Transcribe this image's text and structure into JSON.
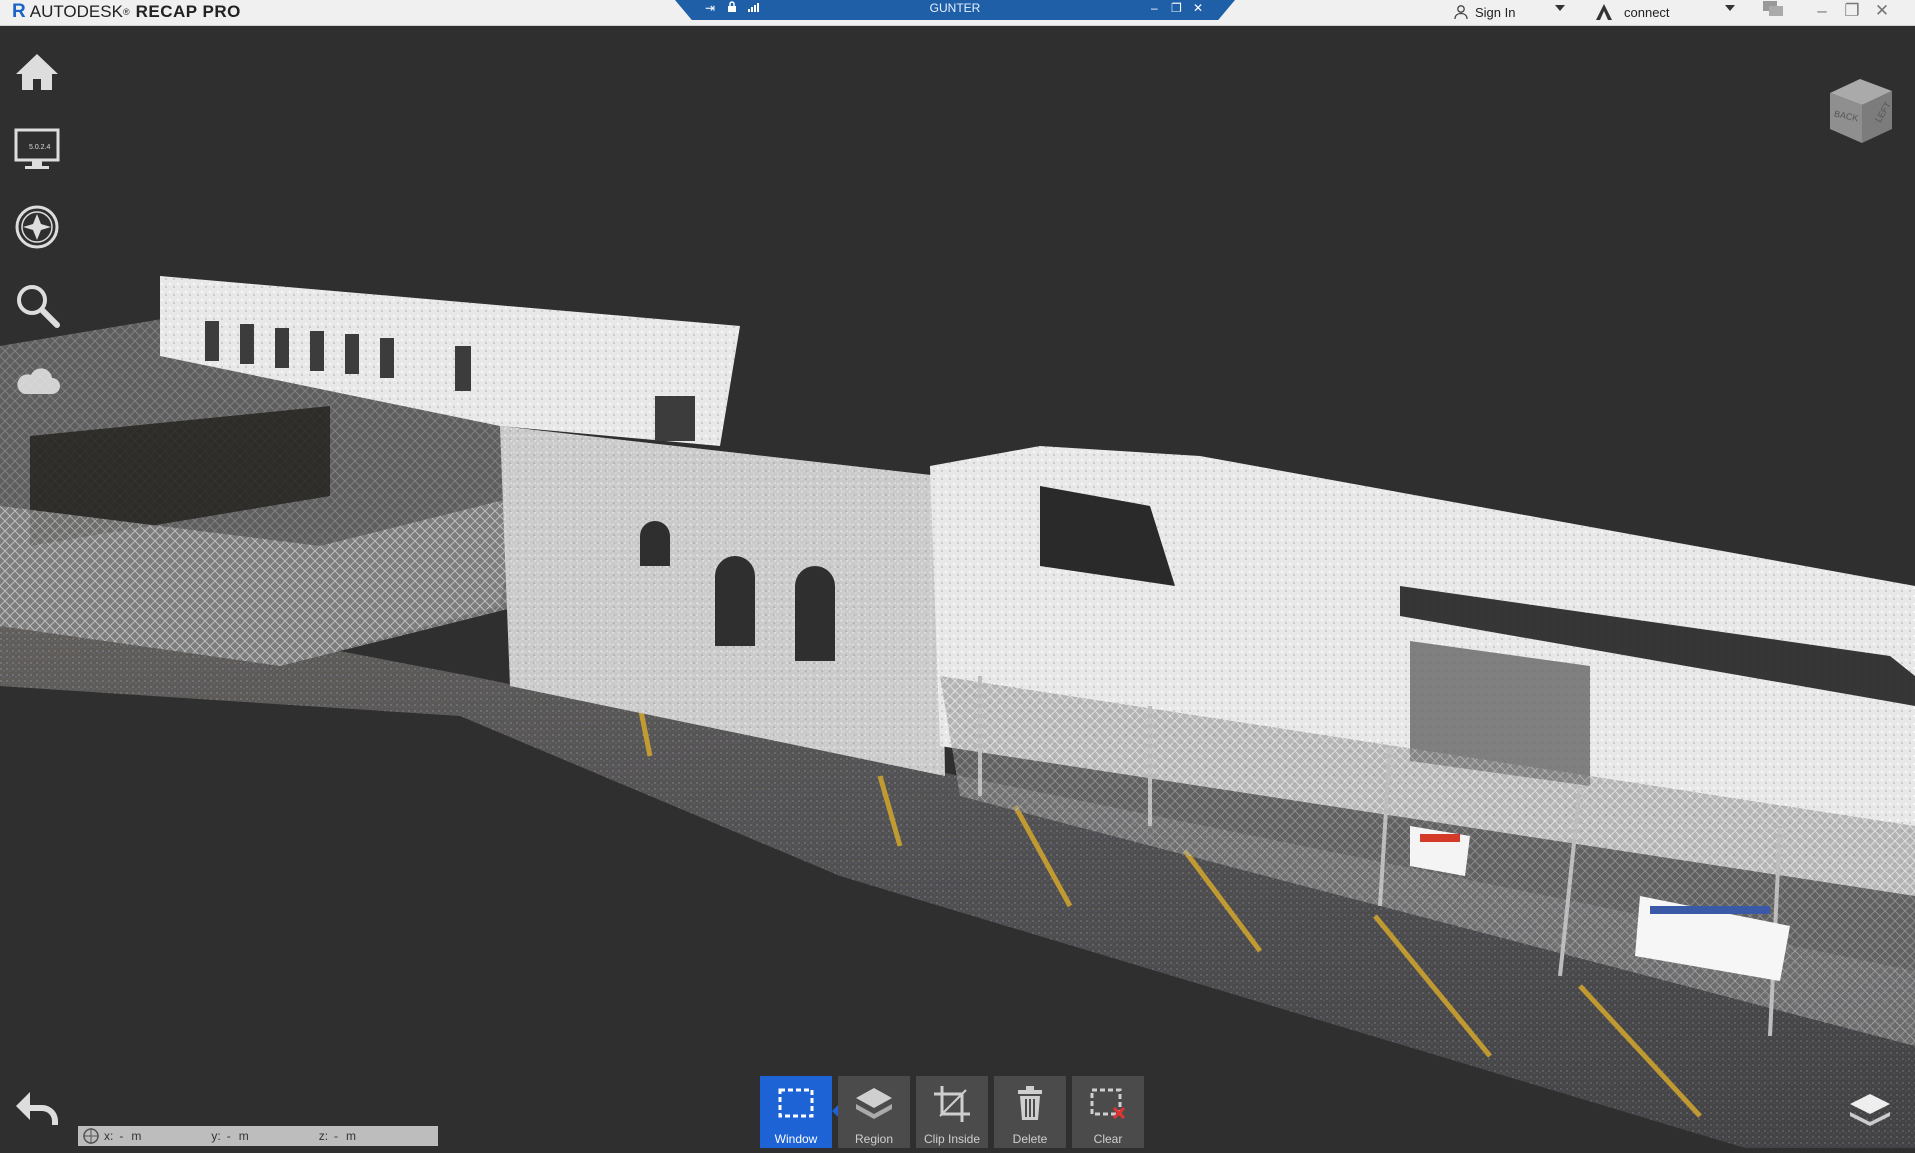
{
  "app": {
    "brand": "AUTODESK",
    "product": "RECAP PRO",
    "logo_letter": "R",
    "accent": "#1e63d6"
  },
  "remote_session": {
    "title": "GUNTER"
  },
  "account": {
    "sign_in": "Sign In",
    "connect": "connect"
  },
  "left_nav": {
    "home": "home-icon",
    "display": "display-settings-icon",
    "display_badge": "5.0.2.4",
    "navigate": "compass-icon",
    "search": "search-icon",
    "cloud": "cloud-icon"
  },
  "viewcube": {
    "face_back": "BACK",
    "face_left": "LEFT"
  },
  "tools": {
    "window": "Window",
    "region": "Region",
    "clip_inside": "Clip Inside",
    "delete": "Delete",
    "clear": "Clear"
  },
  "coordinates": {
    "x_label": "x:",
    "x_value": "-",
    "x_unit": "m",
    "y_label": "y:",
    "y_value": "-",
    "y_unit": "m",
    "z_label": "z:",
    "z_value": "-",
    "z_unit": "m"
  }
}
